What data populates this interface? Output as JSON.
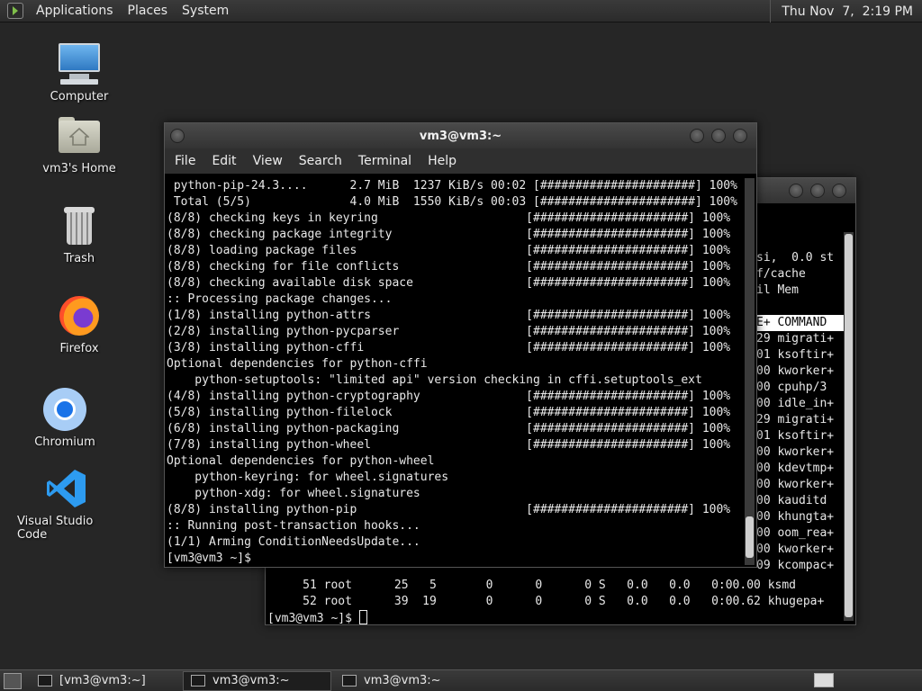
{
  "top_panel": {
    "menus": [
      "Applications",
      "Places",
      "System"
    ],
    "clock": "Thu Nov  7,  2:19 PM"
  },
  "desktop_icons": [
    {
      "label": "Computer",
      "icon": "computer-icon"
    },
    {
      "label": "vm3's Home",
      "icon": "home-folder-icon"
    },
    {
      "label": "Trash",
      "icon": "trash-icon"
    },
    {
      "label": "Firefox",
      "icon": "firefox-icon"
    },
    {
      "label": "Chromium",
      "icon": "chromium-icon"
    },
    {
      "label": "Visual Studio Code",
      "icon": "vscode-icon"
    }
  ],
  "front_window": {
    "title": "vm3@vm3:~",
    "menu": [
      "File",
      "Edit",
      "View",
      "Search",
      "Terminal",
      "Help"
    ],
    "lines": [
      " python-pip-24.3....      2.7 MiB  1237 KiB/s 00:02 [######################] 100%",
      " Total (5/5)              4.0 MiB  1550 KiB/s 00:03 [######################] 100%",
      "(8/8) checking keys in keyring                     [######################] 100%",
      "(8/8) checking package integrity                   [######################] 100%",
      "(8/8) loading package files                        [######################] 100%",
      "(8/8) checking for file conflicts                  [######################] 100%",
      "(8/8) checking available disk space                [######################] 100%",
      ":: Processing package changes...",
      "(1/8) installing python-attrs                      [######################] 100%",
      "(2/8) installing python-pycparser                  [######################] 100%",
      "(3/8) installing python-cffi                       [######################] 100%",
      "Optional dependencies for python-cffi",
      "    python-setuptools: \"limited api\" version checking in cffi.setuptools_ext",
      "(4/8) installing python-cryptography               [######################] 100%",
      "(5/8) installing python-filelock                   [######################] 100%",
      "(6/8) installing python-packaging                  [######################] 100%",
      "(7/8) installing python-wheel                      [######################] 100%",
      "Optional dependencies for python-wheel",
      "    python-keyring: for wheel.signatures",
      "    python-xdg: for wheel.signatures",
      "(8/8) installing python-pip                        [######################] 100%",
      ":: Running post-transaction hooks...",
      "(1/1) Arming ConditionNeedsUpdate...",
      "[vm3@vm3 ~]$ "
    ]
  },
  "back_window": {
    "summary_lines": [
      "si,  0.0 st",
      "f/cache",
      "il Mem"
    ],
    "header_fragment": "E+ COMMAND",
    "proc_fragments": [
      "29 migrati+",
      "01 ksoftir+",
      "00 kworker+",
      "00 cpuhp/3",
      "00 idle_in+",
      "29 migrati+",
      "01 ksoftir+",
      "00 kworker+",
      "00 kdevtmp+",
      "00 kworker+",
      "00 kauditd",
      "00 khungta+",
      "00 oom_rea+",
      "00 kworker+",
      "09 kcompac+"
    ],
    "full_rows": [
      "     51 root      25   5       0      0      0 S   0.0   0.0   0:00.00 ksmd",
      "     52 root      39  19       0      0      0 S   0.0   0.0   0:00.62 khugepa+"
    ],
    "prompt": "[vm3@vm3 ~]$ "
  },
  "taskbar": {
    "tasks": [
      "[vm3@vm3:~]",
      "vm3@vm3:~",
      "vm3@vm3:~"
    ]
  },
  "colors": {
    "desktop_bg": "#262626",
    "terminal_bg": "#000000",
    "terminal_fg": "#e8e8e8",
    "panel_bg": "#333333"
  }
}
